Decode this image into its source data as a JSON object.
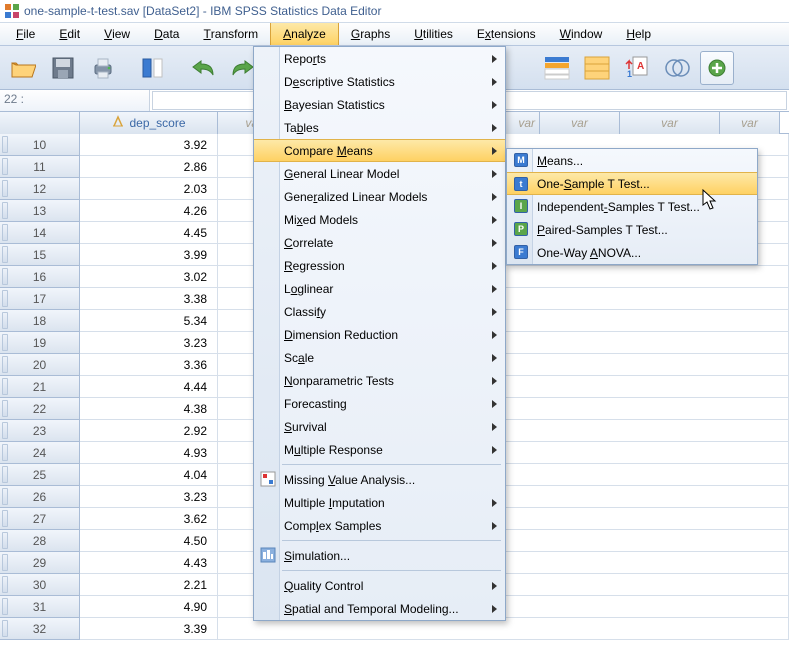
{
  "title": "one-sample-t-test.sav [DataSet2] - IBM SPSS Statistics Data Editor",
  "menubar": {
    "items": [
      {
        "label": "File",
        "u": 0
      },
      {
        "label": "Edit",
        "u": 0
      },
      {
        "label": "View",
        "u": 0
      },
      {
        "label": "Data",
        "u": 0
      },
      {
        "label": "Transform",
        "u": 0
      },
      {
        "label": "Analyze",
        "u": 0,
        "open": true
      },
      {
        "label": "Graphs",
        "u": 0
      },
      {
        "label": "Utilities",
        "u": 0
      },
      {
        "label": "Extensions",
        "u": 1
      },
      {
        "label": "Window",
        "u": 0
      },
      {
        "label": "Help",
        "u": 0
      }
    ]
  },
  "cell_ref": "22 :",
  "columns": [
    {
      "label": "dep_score",
      "type": "scale"
    },
    {
      "label": "var",
      "type": "empty"
    },
    {
      "label": "var",
      "type": "empty"
    },
    {
      "label": "var",
      "type": "empty"
    },
    {
      "label": "var",
      "type": "empty"
    }
  ],
  "rows": [
    {
      "n": "10",
      "v": "3.92"
    },
    {
      "n": "11",
      "v": "2.86"
    },
    {
      "n": "12",
      "v": "2.03"
    },
    {
      "n": "13",
      "v": "4.26"
    },
    {
      "n": "14",
      "v": "4.45"
    },
    {
      "n": "15",
      "v": "3.99"
    },
    {
      "n": "16",
      "v": "3.02"
    },
    {
      "n": "17",
      "v": "3.38"
    },
    {
      "n": "18",
      "v": "5.34"
    },
    {
      "n": "19",
      "v": "3.23"
    },
    {
      "n": "20",
      "v": "3.36"
    },
    {
      "n": "21",
      "v": "4.44"
    },
    {
      "n": "22",
      "v": "4.38"
    },
    {
      "n": "23",
      "v": "2.92"
    },
    {
      "n": "24",
      "v": "4.93"
    },
    {
      "n": "25",
      "v": "4.04"
    },
    {
      "n": "26",
      "v": "3.23"
    },
    {
      "n": "27",
      "v": "3.62"
    },
    {
      "n": "28",
      "v": "4.50"
    },
    {
      "n": "29",
      "v": "4.43"
    },
    {
      "n": "30",
      "v": "2.21"
    },
    {
      "n": "31",
      "v": "4.90"
    },
    {
      "n": "32",
      "v": "3.39"
    }
  ],
  "analyze_menu": [
    {
      "label": "Reports",
      "sub": true,
      "u": 4
    },
    {
      "label": "Descriptive Statistics",
      "sub": true,
      "u": 1
    },
    {
      "label": "Bayesian Statistics",
      "sub": true,
      "u": 0
    },
    {
      "label": "Tables",
      "sub": true,
      "u": 2
    },
    {
      "label": "Compare Means",
      "sub": true,
      "u": 8,
      "hl": true
    },
    {
      "label": "General Linear Model",
      "sub": true,
      "u": 0
    },
    {
      "label": "Generalized Linear Models",
      "sub": true,
      "u": 4
    },
    {
      "label": "Mixed Models",
      "sub": true,
      "u": 2
    },
    {
      "label": "Correlate",
      "sub": true,
      "u": 0
    },
    {
      "label": "Regression",
      "sub": true,
      "u": 0
    },
    {
      "label": "Loglinear",
      "sub": true,
      "u": 1
    },
    {
      "label": "Classify",
      "sub": true,
      "u": 6
    },
    {
      "label": "Dimension Reduction",
      "sub": true,
      "u": 0
    },
    {
      "label": "Scale",
      "sub": true,
      "u": 2
    },
    {
      "label": "Nonparametric Tests",
      "sub": true,
      "u": 0
    },
    {
      "label": "Forecasting",
      "sub": true,
      "u": 10
    },
    {
      "label": "Survival",
      "sub": true,
      "u": 0
    },
    {
      "label": "Multiple Response",
      "sub": true,
      "u": 1
    },
    {
      "label": "Missing Value Analysis...",
      "sub": false,
      "u": 8,
      "icon": "mva"
    },
    {
      "label": "Multiple Imputation",
      "sub": true,
      "u": 9
    },
    {
      "label": "Complex Samples",
      "sub": true,
      "u": 4
    },
    {
      "label": "Simulation...",
      "sub": false,
      "u": 0,
      "icon": "sim"
    },
    {
      "label": "Quality Control",
      "sub": true,
      "u": 0
    },
    {
      "label": "Spatial and Temporal Modeling...",
      "sub": true,
      "u": 0
    }
  ],
  "submenu": [
    {
      "label": "Means...",
      "u": 0,
      "icon": "M",
      "color": "#3b7bd1"
    },
    {
      "label": "One-Sample T Test...",
      "u": 4,
      "icon": "t",
      "color": "#3b7bd1",
      "hl": true
    },
    {
      "label": "Independent-Samples T Test...",
      "u": 11,
      "icon": "I",
      "color": "#5aa54a"
    },
    {
      "label": "Paired-Samples T Test...",
      "u": 0,
      "icon": "P",
      "color": "#5aa54a"
    },
    {
      "label": "One-Way ANOVA...",
      "u": 8,
      "icon": "F",
      "color": "#3b7bd1"
    }
  ]
}
